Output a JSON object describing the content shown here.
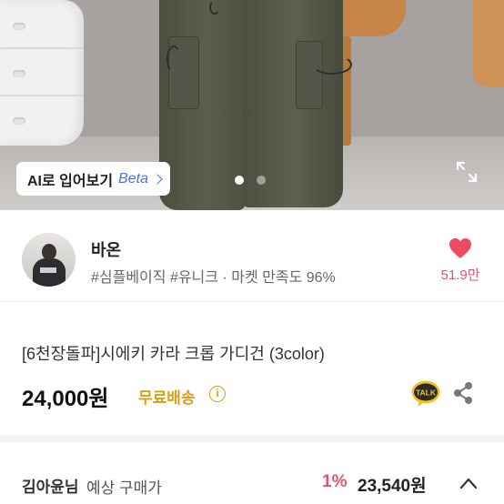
{
  "hero": {
    "ai_button": {
      "label": "AI로 입어보기",
      "beta": "Beta"
    },
    "pagination": {
      "total": 2,
      "active": 0
    },
    "icons": {
      "expand": "expand-icon"
    }
  },
  "seller": {
    "name": "바온",
    "tags": "#심플베이직 #유니크",
    "satisfaction": "· 마켓 만족도 96%",
    "likes": "51.9만",
    "icons": {
      "heart": "heart-icon"
    }
  },
  "product": {
    "title": "[6천장돌파]시에키 카라 크롭 가디건 (3color)",
    "price": "24,000원",
    "shipping": "무료배송",
    "info": "i",
    "icons": {
      "talk": "kakao-talk-icon",
      "share": "share-icon"
    }
  },
  "buyer": {
    "name": "김아윤님",
    "label": "예상 구매가",
    "discount": "1%",
    "price": "23,540원",
    "icons": {
      "toggle": "chevron-up-icon"
    }
  },
  "colors": {
    "accent_pink": "#e0566c",
    "shipping_yellow": "#d9a015",
    "beta_blue": "#4b73d8",
    "talk_yellow": "#f2c31a"
  }
}
